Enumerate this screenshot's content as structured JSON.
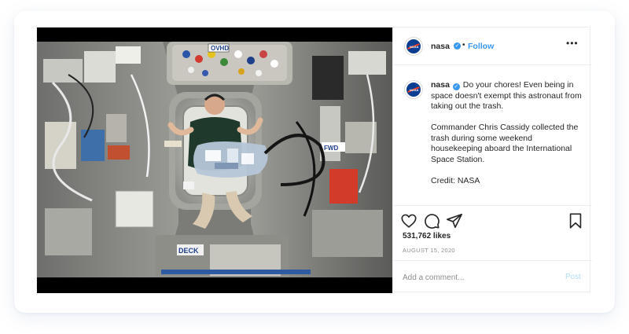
{
  "post": {
    "username": "nasa",
    "follow_label": "Follow",
    "separator": "•",
    "more_label": "•••",
    "avatar_logo": "NASA",
    "caption_paragraphs": [
      "Do your chores! Even being in space doesn't exempt this astronaut from taking out the trash.",
      "Commander Chris Cassidy collected the trash during some weekend housekeeping aboard the International Space Station.",
      "Credit: NASA"
    ],
    "likes": "531,762 likes",
    "date": "AUGUST 15, 2020",
    "comment_placeholder": "Add a comment...",
    "post_label": "Post",
    "verified_icon": "verified-badge-icon"
  },
  "photo": {
    "labels": {
      "ovhd": "OVHD",
      "fwd": "FWD",
      "deck": "DECK"
    }
  },
  "colors": {
    "accent": "#3897f0",
    "post_disabled": "#b2dffc",
    "nasa_blue": "#0b3d91",
    "nasa_red": "#fc3d21"
  },
  "icons": [
    "heart-icon",
    "comment-icon",
    "share-icon",
    "bookmark-icon"
  ]
}
